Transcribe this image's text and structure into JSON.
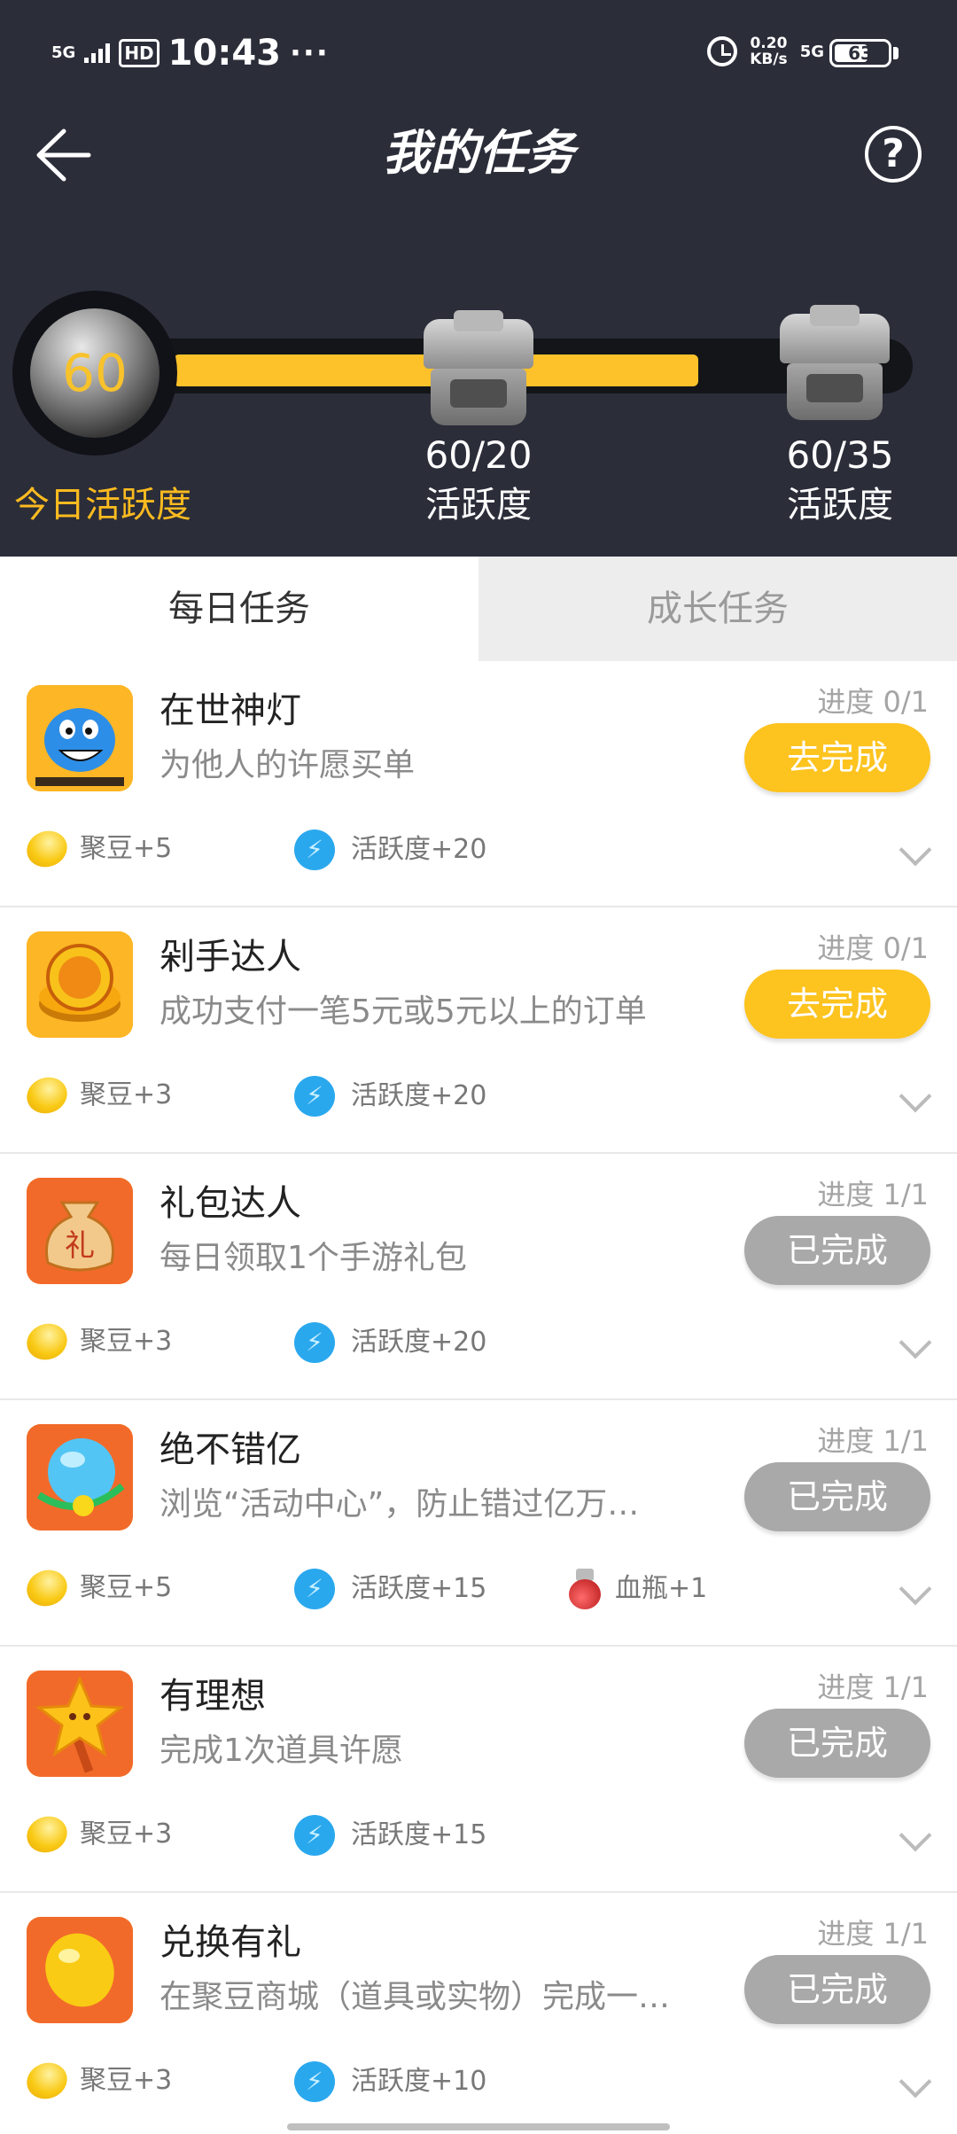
{
  "status_bar": {
    "network": "5G",
    "hd": "HD",
    "time": "10:43",
    "more": "···",
    "speed_value": "0.20",
    "speed_unit": "KB/s",
    "network_right": "5G",
    "battery": "63"
  },
  "nav": {
    "title": "我的任务",
    "help": "?"
  },
  "activity": {
    "score": "60",
    "score_label": "今日活跃度",
    "progress_fraction": 0.67,
    "milestones": [
      {
        "value": "60/20",
        "label": "活跃度"
      },
      {
        "value": "60/35",
        "label": "活跃度"
      }
    ]
  },
  "tabs": {
    "daily": "每日任务",
    "growth": "成长任务"
  },
  "tasks": [
    {
      "title": "在世神灯",
      "desc": "为他人的许愿买单",
      "progress": "进度 0/1",
      "button": "去完成",
      "done": false,
      "icon": "genie-lamp-icon",
      "rewards": [
        {
          "icon": "bean-icon",
          "text": "聚豆+5"
        },
        {
          "icon": "activity-icon",
          "text": "活跃度+20"
        }
      ]
    },
    {
      "title": "剁手达人",
      "desc": "成功支付一笔5元或5元以上的订单",
      "progress": "进度 0/1",
      "button": "去完成",
      "done": false,
      "icon": "coins-icon",
      "rewards": [
        {
          "icon": "bean-icon",
          "text": "聚豆+3"
        },
        {
          "icon": "activity-icon",
          "text": "活跃度+20"
        }
      ]
    },
    {
      "title": "礼包达人",
      "desc": "每日领取1个手游礼包",
      "progress": "进度 1/1",
      "button": "已完成",
      "done": true,
      "icon": "gift-bag-icon",
      "rewards": [
        {
          "icon": "bean-icon",
          "text": "聚豆+3"
        },
        {
          "icon": "activity-icon",
          "text": "活跃度+20"
        }
      ]
    },
    {
      "title": "绝不错亿",
      "desc": "浏览“活动中心”，防止错过亿万…",
      "progress": "进度 1/1",
      "button": "已完成",
      "done": true,
      "icon": "globe-icon",
      "rewards": [
        {
          "icon": "bean-icon",
          "text": "聚豆+5"
        },
        {
          "icon": "activity-icon",
          "text": "活跃度+15"
        },
        {
          "icon": "potion-icon",
          "text": "血瓶+1"
        }
      ]
    },
    {
      "title": "有理想",
      "desc": "完成1次道具许愿",
      "progress": "进度 1/1",
      "button": "已完成",
      "done": true,
      "icon": "star-wand-icon",
      "rewards": [
        {
          "icon": "bean-icon",
          "text": "聚豆+3"
        },
        {
          "icon": "activity-icon",
          "text": "活跃度+15"
        }
      ]
    },
    {
      "title": "兑换有礼",
      "desc": "在聚豆商城（道具或实物）完成一…",
      "progress": "进度 1/1",
      "button": "已完成",
      "done": true,
      "icon": "bean-big-icon",
      "rewards": [
        {
          "icon": "bean-icon",
          "text": "聚豆+3"
        },
        {
          "icon": "activity-icon",
          "text": "活跃度+10"
        }
      ]
    }
  ]
}
